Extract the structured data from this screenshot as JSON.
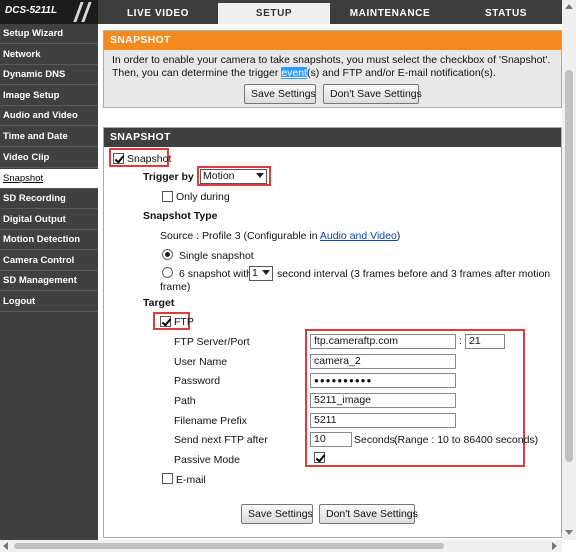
{
  "model": "DCS-5211L",
  "tabs": [
    {
      "label": "LIVE VIDEO"
    },
    {
      "label": "SETUP"
    },
    {
      "label": "MAINTENANCE"
    },
    {
      "label": "STATUS"
    }
  ],
  "sidebar": {
    "items": [
      {
        "label": "Setup Wizard"
      },
      {
        "label": "Network"
      },
      {
        "label": "Dynamic DNS"
      },
      {
        "label": "Image Setup"
      },
      {
        "label": "Audio and Video"
      },
      {
        "label": "Time and Date"
      },
      {
        "label": "Video Clip"
      },
      {
        "label": "Snapshot"
      },
      {
        "label": "SD Recording"
      },
      {
        "label": "Digital Output"
      },
      {
        "label": "Motion Detection"
      },
      {
        "label": "Camera Control"
      },
      {
        "label": "SD Management"
      },
      {
        "label": "Logout"
      }
    ],
    "active": "Snapshot"
  },
  "info": {
    "title": "SNAPSHOT",
    "text_before": "In order to enable your camera to take snapshots, you must select the checkbox of 'Snapshot'. Then, you can determine the trigger ",
    "text_highlight": "event",
    "text_after": "(s) and FTP and/or E-mail notification(s).",
    "save_label": "Save Settings",
    "dont_save_label": "Don't Save Settings"
  },
  "snapshot": {
    "title": "SNAPSHOT",
    "enable_label": "Snapshot",
    "enable_checked": true,
    "trigger_label": "Trigger by",
    "trigger_value": "Motion",
    "only_during_label": "Only during",
    "only_during_checked": false,
    "type_label": "Snapshot Type",
    "source_prefix": "Source : Profile 3 (Configurable in ",
    "source_link": "Audio and Video",
    "source_suffix": ")",
    "single_label": "Single snapshot",
    "single_selected": true,
    "multi_prefix": "6 snapshot with",
    "multi_interval": "1",
    "multi_suffix": "second interval (3 frames before and 3 frames after motion",
    "multi_suffix2": "frame)",
    "target_label": "Target",
    "ftp_label": "FTP",
    "ftp_checked": true,
    "ftp": {
      "server_label": "FTP Server/Port",
      "server": "ftp.cameraftp.com",
      "port_sep": ":",
      "port": "21",
      "user_label": "User Name",
      "user": "camera_2",
      "password_label": "Password",
      "password": "●●●●●●●●●●",
      "path_label": "Path",
      "path": "5211_image",
      "prefix_label": "Filename Prefix",
      "prefix": "5211",
      "send_label": "Send next FTP after",
      "send_value": "10",
      "send_unit": "Seconds",
      "send_range": "(Range : 10 to 86400 seconds)",
      "passive_label": "Passive Mode",
      "passive_checked": true
    },
    "email_label": "E-mail",
    "email_checked": false,
    "save_label": "Save Settings",
    "dont_save_label": "Don't Save Settings"
  },
  "colors": {
    "accent": "#f58a1f",
    "header_dark": "#3f3f3f",
    "highlight_box": "#e03a3a",
    "link": "#0645ad"
  }
}
